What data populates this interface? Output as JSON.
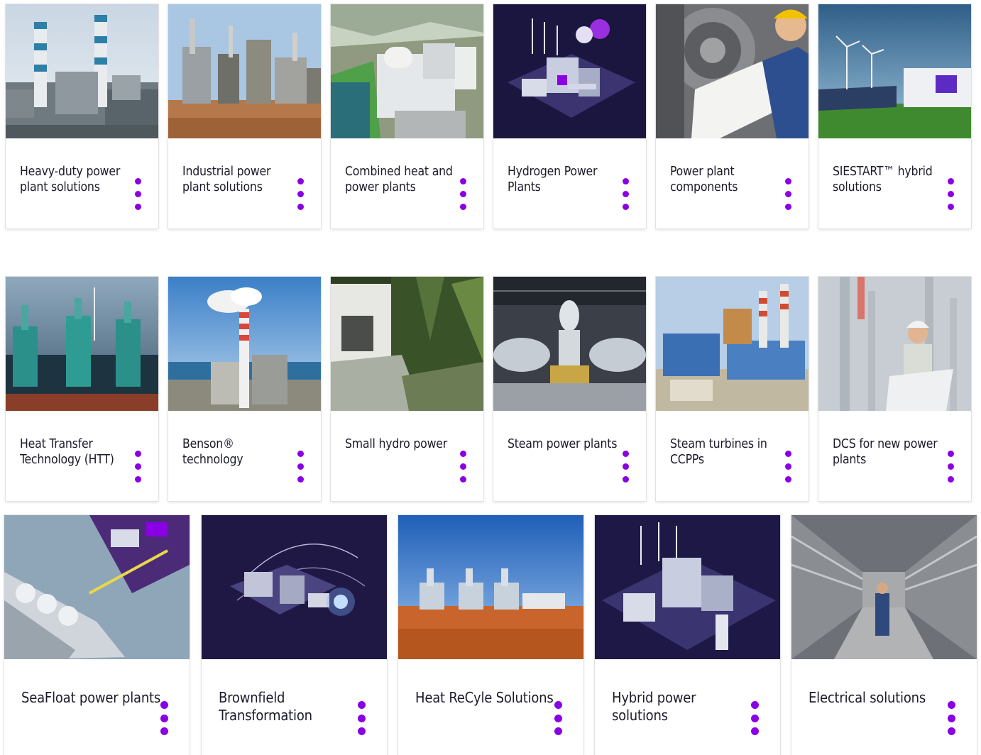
{
  "accent_color": "#8a00e5",
  "rows": [
    {
      "cards": [
        {
          "label": "Heavy-duty power plant solutions",
          "image": "power-plant-chimneys-image",
          "icon": "more-options-icon"
        },
        {
          "label": "Industrial power plant solutions",
          "image": "industrial-plant-image",
          "icon": "more-options-icon"
        },
        {
          "label": "Combined heat and power plants",
          "image": "chp-plant-aerial-image",
          "icon": "more-options-icon"
        },
        {
          "label": "Hydrogen Power Plants",
          "image": "hydrogen-plant-illustration-image",
          "icon": "more-options-icon"
        },
        {
          "label": "Power plant components",
          "image": "engineer-turbine-image",
          "icon": "more-options-icon"
        },
        {
          "label": "SIESTART™ hybrid solutions",
          "image": "wind-solar-storage-image",
          "icon": "more-options-icon"
        }
      ]
    },
    {
      "cards": [
        {
          "label": "Heat Transfer Technology (HTT)",
          "image": "plant-at-dusk-image",
          "icon": "more-options-icon"
        },
        {
          "label": "Benson® technology",
          "image": "smokestack-coast-image",
          "icon": "more-options-icon"
        },
        {
          "label": "Small hydro power",
          "image": "hydro-building-forest-image",
          "icon": "more-options-icon"
        },
        {
          "label": "Steam power plants",
          "image": "turbine-hall-image",
          "icon": "more-options-icon"
        },
        {
          "label": "Steam turbines in CCPPs",
          "image": "ccpp-plant-image",
          "icon": "more-options-icon"
        },
        {
          "label": "DCS for new power plants",
          "image": "engineer-refinery-image",
          "icon": "more-options-icon"
        }
      ]
    },
    {
      "cards": [
        {
          "label": "SeaFloat power plants",
          "image": "lng-ship-illustration-image",
          "icon": "more-options-icon"
        },
        {
          "label": "Brownfield Transformation",
          "image": "brownfield-illustration-image",
          "icon": "more-options-icon"
        },
        {
          "label": "Heat ReCyle Solutions",
          "image": "desert-plant-image",
          "icon": "more-options-icon"
        },
        {
          "label": "Hybrid power solutions",
          "image": "hybrid-plant-illustration-image",
          "icon": "more-options-icon"
        },
        {
          "label": "Electrical solutions",
          "image": "electrical-aisle-image",
          "icon": "more-options-icon"
        }
      ]
    }
  ]
}
